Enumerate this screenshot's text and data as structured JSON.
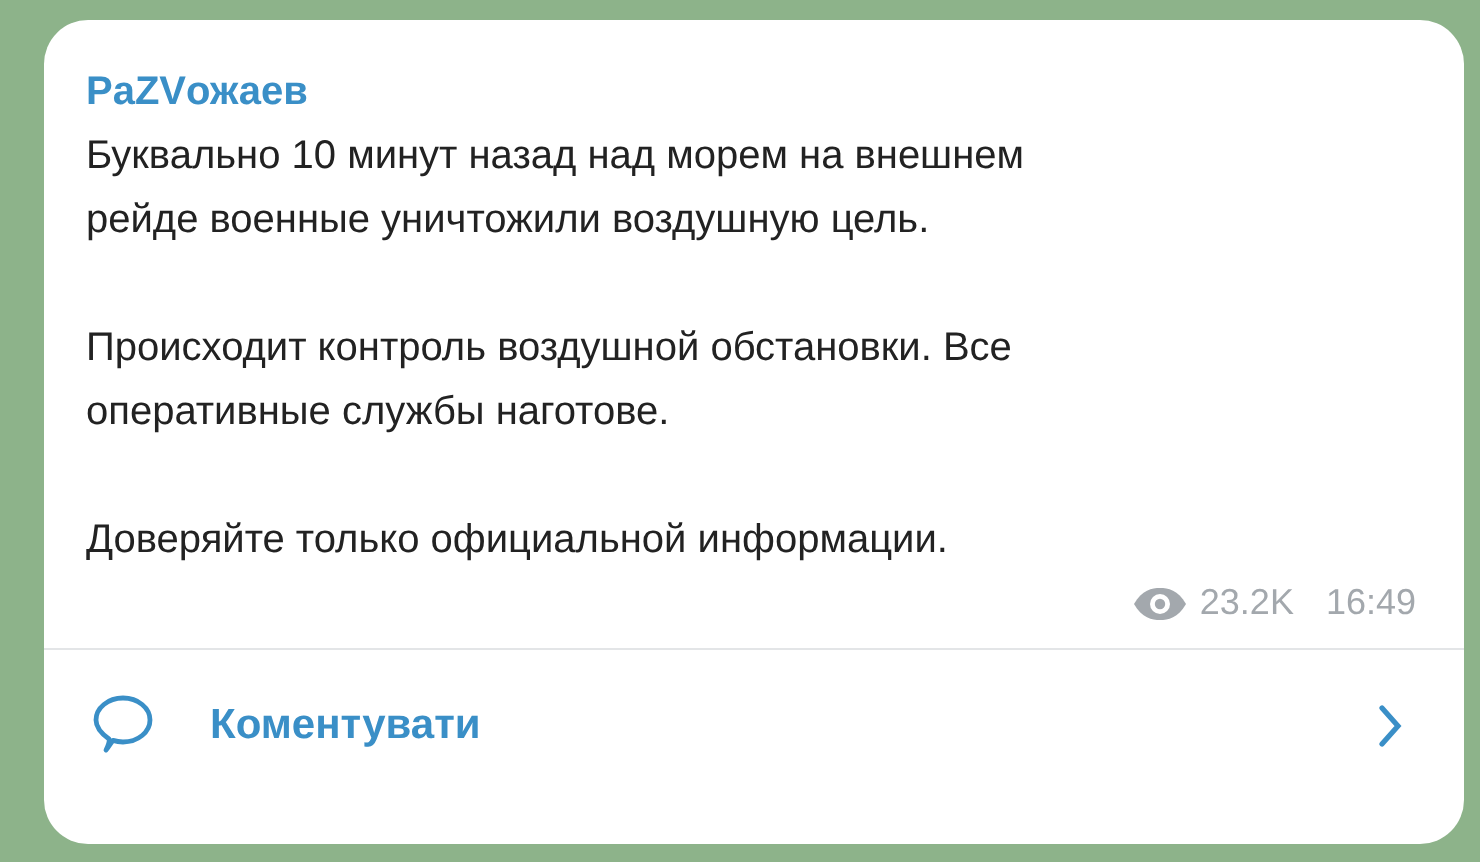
{
  "message": {
    "sender": "PaZVожаев",
    "paragraphs": [
      "Буквально 10 минут назад над морем на внешнем\nрейде военные уничтожили воздушную цель.",
      "Происходит контроль воздушной обстановки. Все\nоперативные службы наготове.",
      "Доверяйте только официальной информации."
    ],
    "views": "23.2K",
    "time": "16:49"
  },
  "comment_button": {
    "label": "Коментувати"
  }
}
